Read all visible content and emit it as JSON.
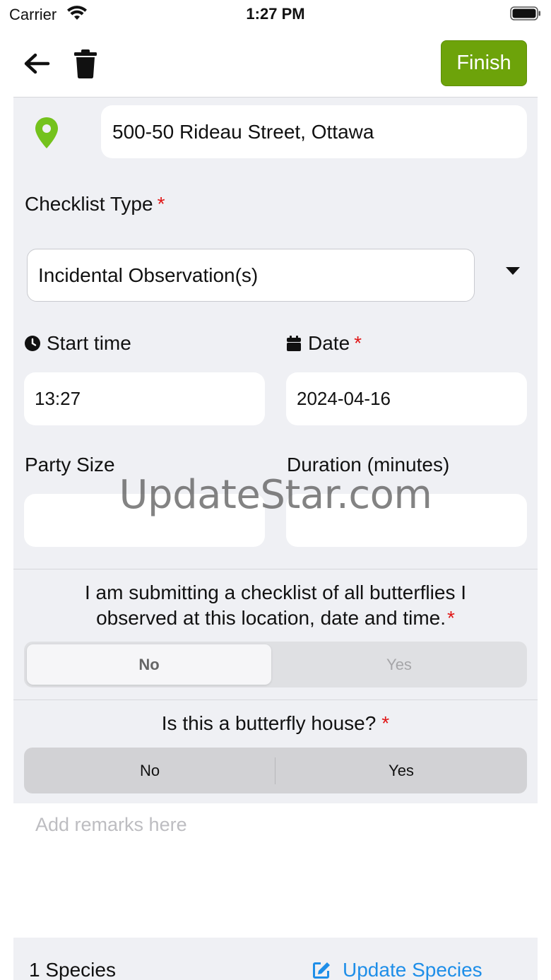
{
  "status_bar": {
    "carrier": "Carrier",
    "time": "1:27 PM"
  },
  "top_bar": {
    "finish_label": "Finish",
    "finish_color": "#6da30a"
  },
  "location": {
    "address": "500-50 Rideau Street, Ottawa",
    "icon": "location-pin-icon",
    "icon_color": "#74c21c"
  },
  "checklist_type": {
    "label": "Checklist Type",
    "required_mark": "*",
    "value": "Incidental Observation(s)"
  },
  "start_time": {
    "label": "Start time",
    "value": "13:27",
    "icon": "clock-icon"
  },
  "date": {
    "label": "Date",
    "required_mark": "*",
    "value": "2024-04-16",
    "icon": "calendar-icon"
  },
  "party_size": {
    "label": "Party Size",
    "value": ""
  },
  "duration": {
    "label": "Duration (minutes)",
    "value": ""
  },
  "all_butterflies_question": {
    "text": "I am submitting a checklist of all butterflies I observed at this location, date and time.",
    "required_mark": "*",
    "options": [
      "No",
      "Yes"
    ],
    "selected": "No"
  },
  "butterfly_house_question": {
    "text": "Is this a butterfly house?",
    "required_mark": "*",
    "options": [
      "No",
      "Yes"
    ]
  },
  "remarks": {
    "placeholder": "Add remarks here"
  },
  "footer": {
    "species_count": "1 Species",
    "update_label": "Update Species",
    "link_color": "#1e8ee8"
  },
  "watermark": "UpdateStar.com"
}
